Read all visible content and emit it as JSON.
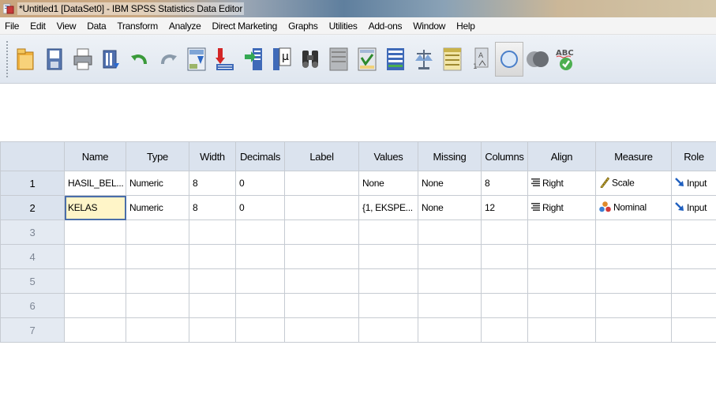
{
  "window": {
    "title": "*Untitled1 [DataSet0] - IBM SPSS Statistics Data Editor"
  },
  "menu": [
    "File",
    "Edit",
    "View",
    "Data",
    "Transform",
    "Analyze",
    "Direct Marketing",
    "Graphs",
    "Utilities",
    "Add-ons",
    "Window",
    "Help"
  ],
  "toolbar": {
    "icons": [
      "open-icon",
      "save-icon",
      "print-icon",
      "dialog-recall-icon",
      "undo-icon",
      "redo-icon",
      "goto-case-icon",
      "goto-variable-icon",
      "variables-icon",
      "run-descriptives-icon",
      "find-icon",
      "insert-cases-icon",
      "insert-variable-icon",
      "split-file-icon",
      "weight-cases-icon",
      "select-cases-icon",
      "value-labels-icon",
      "use-sets-icon",
      "show-all-variables-icon",
      "spell-check-icon"
    ],
    "spell_label": "ABC"
  },
  "grid": {
    "columns": [
      "Name",
      "Type",
      "Width",
      "Decimals",
      "Label",
      "Values",
      "Missing",
      "Columns",
      "Align",
      "Measure",
      "Role"
    ],
    "rows": [
      {
        "num": "1",
        "name": "HASIL_BEL...",
        "type": "Numeric",
        "width": "8",
        "decimals": "0",
        "label": "",
        "values": "None",
        "missing": "None",
        "columns": "8",
        "align": "Right",
        "measure": "Scale",
        "measure_icon": "scale-ruler-icon",
        "role": "Input"
      },
      {
        "num": "2",
        "name": "KELAS",
        "type": "Numeric",
        "width": "8",
        "decimals": "0",
        "label": "",
        "values": "{1, EKSPE...",
        "missing": "None",
        "columns": "12",
        "align": "Right",
        "measure": "Nominal",
        "measure_icon": "nominal-icon",
        "role": "Input"
      }
    ],
    "empty_rows": [
      "3",
      "4",
      "5",
      "6",
      "7"
    ]
  },
  "colors": {
    "header_bg": "#dbe3ee",
    "selected_cell_bg": "#fff5c8",
    "selected_cell_border": "#4a6ea9"
  }
}
